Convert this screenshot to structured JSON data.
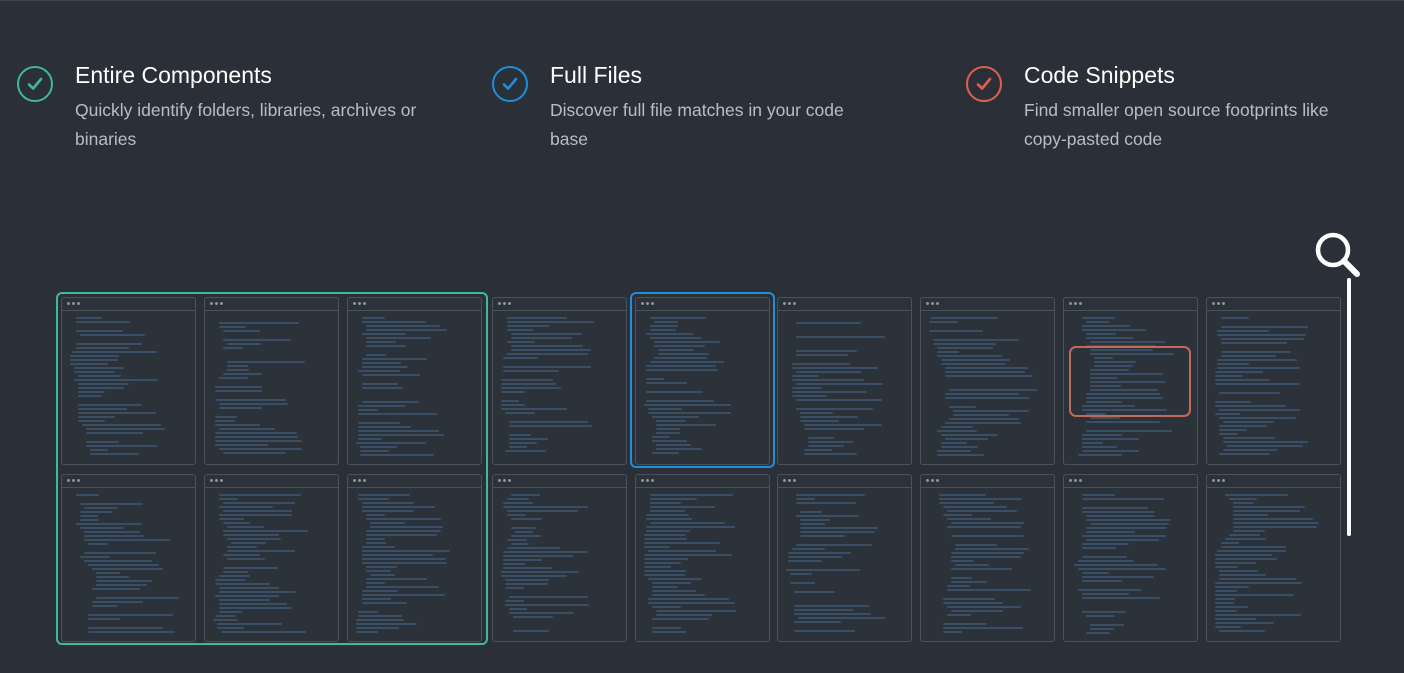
{
  "features": [
    {
      "title": "Entire Components",
      "description": "Quickly identify folders, libraries, archives or binaries",
      "color": "#3fb89b",
      "icon": "check-circle-icon"
    },
    {
      "title": "Full Files",
      "description": "Discover full file matches in your code base",
      "color": "#1f8fd6",
      "icon": "check-circle-icon"
    },
    {
      "title": "Code Snippets",
      "description": "Find smaller open source footprints like copy-pasted code",
      "color": "#e2604f",
      "icon": "check-circle-icon"
    }
  ],
  "scanner": {
    "icon": "magnifier-icon"
  }
}
